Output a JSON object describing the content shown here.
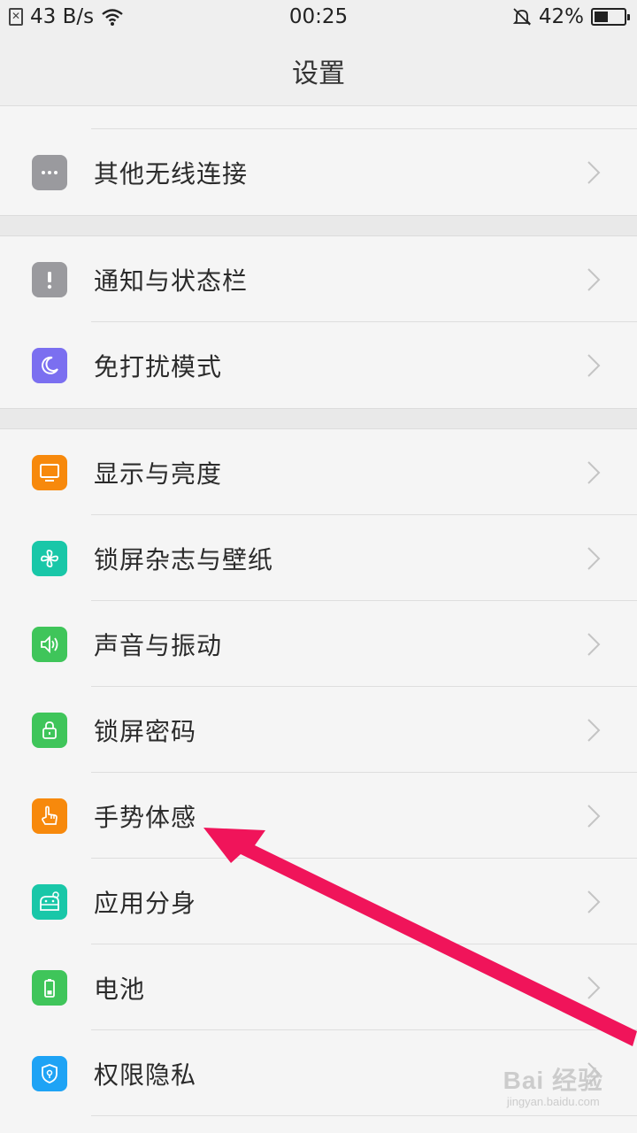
{
  "status_bar": {
    "network_speed": "43 B/s",
    "time": "00:25",
    "battery_percent": "42%",
    "battery_level": 0.42
  },
  "header": {
    "title": "设置"
  },
  "rows": [
    {
      "label": "其他无线连接",
      "icon": "more-dots-icon",
      "color": "#9a9a9e"
    },
    {
      "label": "通知与状态栏",
      "icon": "exclamation-icon",
      "color": "#9a9a9e"
    },
    {
      "label": "免打扰模式",
      "icon": "moon-icon",
      "color": "#7b6ff0"
    },
    {
      "label": "显示与亮度",
      "icon": "monitor-icon",
      "color": "#f7890c"
    },
    {
      "label": "锁屏杂志与壁纸",
      "icon": "pinwheel-icon",
      "color": "#19c7a8"
    },
    {
      "label": "声音与振动",
      "icon": "speaker-icon",
      "color": "#3fc55a"
    },
    {
      "label": "锁屏密码",
      "icon": "lock-icon",
      "color": "#3fc55a"
    },
    {
      "label": "手势体感",
      "icon": "hand-gesture-icon",
      "color": "#f7890c"
    },
    {
      "label": "应用分身",
      "icon": "app-clone-icon",
      "color": "#19c7a8"
    },
    {
      "label": "电池",
      "icon": "battery-icon",
      "color": "#3fc55a"
    },
    {
      "label": "权限隐私",
      "icon": "shield-icon",
      "color": "#1ea3f5"
    }
  ],
  "watermark": {
    "main": "Bai 经验",
    "sub": "jingyan.baidu.com"
  },
  "annotation": {
    "color": "#f0145a"
  }
}
